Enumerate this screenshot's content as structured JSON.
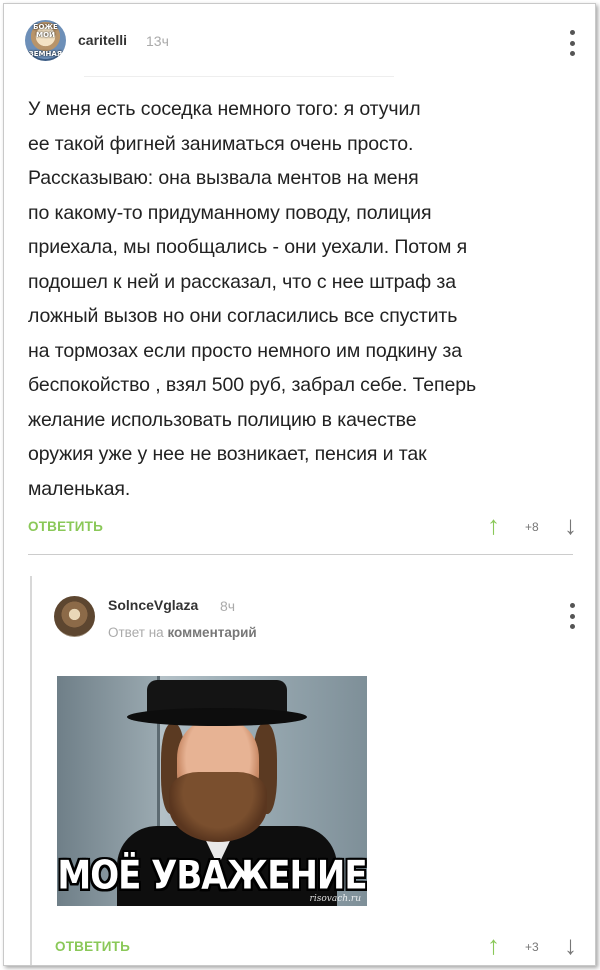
{
  "comment": {
    "avatar_caption_top": "БОЖЕ МОЙ",
    "avatar_caption_bottom": "ЗЕМНАЯ",
    "username": "caritelli",
    "time": "13ч",
    "text": "У меня есть соседка немного того: я отучил\nее такой фигней заниматься очень просто.\nРассказываю: она вызвала ментов на меня\nпо какому-то придуманному поводу, полиция\nприехала, мы пообщались - они уехали. Потом я\nподошел к ней и рассказал, что с нее штраф за\nложный вызов но они согласились все спустить\nна тормозах если просто немного им подкину за\nбеспокойство , взял 500 руб, забрал себе. Теперь\nжелание использовать полицию в качестве\nоружия уже у нее не возникает, пенсия и так\nмаленькая.",
    "reply_label": "ОТВЕТИТЬ",
    "score": "+8"
  },
  "reply": {
    "username": "SolnceVglaza",
    "time": "8ч",
    "meta_prefix": "Ответ на",
    "meta_link": "комментарий",
    "meme_caption": "МОЁ УВАЖЕНИЕ",
    "meme_watermark": "risovach.ru",
    "reply_label": "ОТВЕТИТЬ",
    "score": "+3"
  },
  "icons": {
    "upvote": "arrow-up-icon",
    "downvote": "arrow-down-icon",
    "more": "more-vertical-icon"
  },
  "colors": {
    "accent_green": "#8ac858",
    "text": "#222222",
    "muted": "#aaaaaa"
  }
}
